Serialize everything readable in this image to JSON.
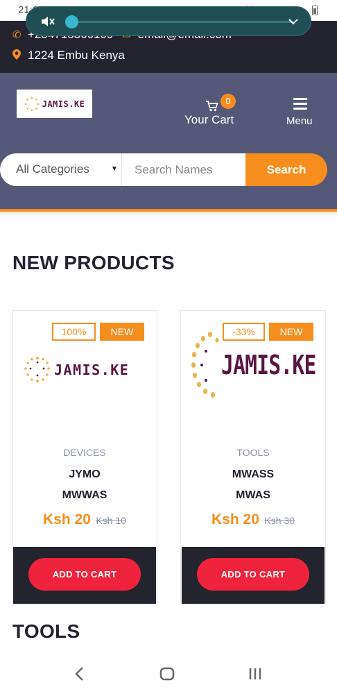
{
  "status_bar": {
    "time": "21:0"
  },
  "contact": {
    "phone": "+254718360109",
    "email": "email@email.com",
    "address": "1224 Embu Kenya"
  },
  "media_overlay": {
    "volume_fraction": 0.02
  },
  "header": {
    "logo_text": "JAMIS.KE",
    "cart_count": "0",
    "cart_label": "Your Cart",
    "menu_label": "Menu"
  },
  "search": {
    "category_label": "All Categories",
    "placeholder": "Search Names",
    "button_label": "Search"
  },
  "sections": {
    "new_products": "NEW PRODUCTS",
    "tools": "TOOLS"
  },
  "products": [
    {
      "discount_badge": "100%",
      "new_badge": "NEW",
      "logo_text": "JAMIS.KE",
      "category": "DEVICES",
      "name_line1": "JYMO",
      "name_line2": "MWWAS",
      "price": "Ksh 20",
      "old_price": "Ksh 10",
      "cta": "ADD TO CART"
    },
    {
      "discount_badge": "-33%",
      "new_badge": "NEW",
      "logo_text": "JAMIS.KE",
      "category": "TOOLS",
      "name_line1": "MWASS",
      "name_line2": "MWAS",
      "price": "Ksh 20",
      "old_price": "Ksh 30",
      "cta": "ADD TO CART"
    }
  ],
  "colors": {
    "accent": "#f68e1e",
    "dark": "#24242e",
    "header_bg": "#555879",
    "cta_red": "#ef233c",
    "logo_text": "#5a1545"
  },
  "icons": {
    "phone": "phone-icon",
    "email": "email-icon",
    "location": "location-pin-icon",
    "cart": "cart-icon",
    "menu": "hamburger-menu-icon",
    "mute": "volume-mute-icon",
    "collapse": "chevron-down-icon",
    "back": "back-icon",
    "home": "home-icon",
    "recents": "recent-apps-icon"
  }
}
